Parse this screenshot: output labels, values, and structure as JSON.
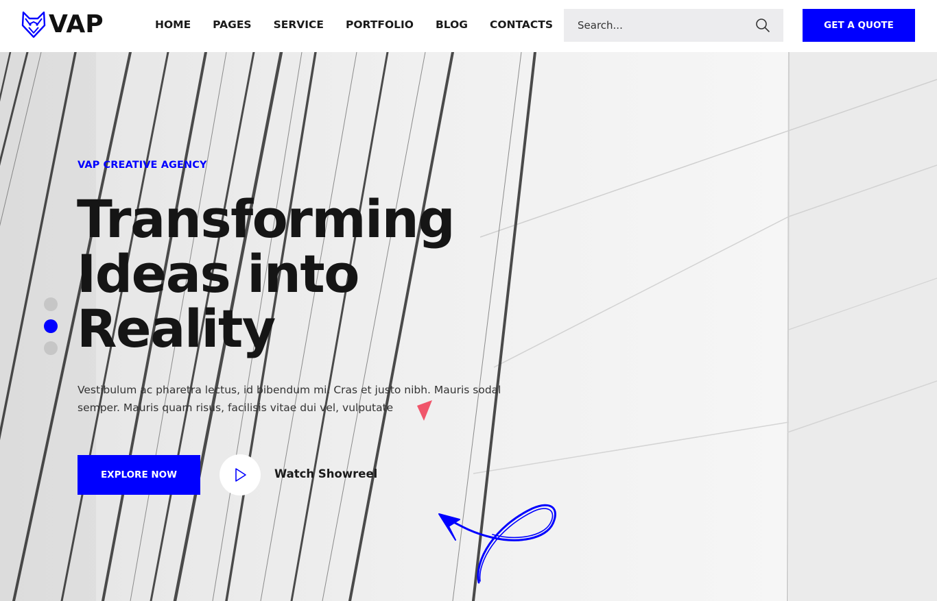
{
  "brand": {
    "name": "VAP",
    "accent": "#0000ff"
  },
  "nav": {
    "items": [
      {
        "label": "HOME"
      },
      {
        "label": "PAGES"
      },
      {
        "label": "SERVICE"
      },
      {
        "label": "PORTFOLIO"
      },
      {
        "label": "BLOG"
      },
      {
        "label": "CONTACTS"
      }
    ]
  },
  "search": {
    "placeholder": "Search...",
    "icon": "search-icon"
  },
  "header": {
    "cta_label": "GET A QUOTE"
  },
  "hero": {
    "tagline": "VAP CREATIVE AGENCY",
    "headline_lines": [
      "Transforming",
      "Ideas into",
      "Reality"
    ],
    "description": "Vestibulum ac pharetra lectus, id bibendum mi. Cras et justo nibh. Mauris sodal semper. Mauris quam risus, facilisis vitae dui vel, vulputate",
    "primary_cta": "EXPLORE NOW",
    "secondary_cta": "Watch Showreel",
    "slider": {
      "count": 3,
      "active": 2
    }
  }
}
